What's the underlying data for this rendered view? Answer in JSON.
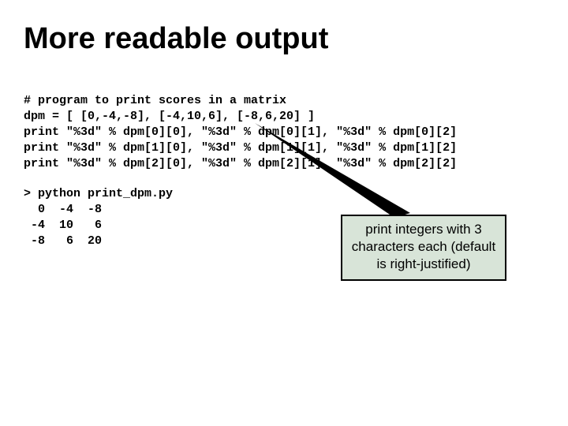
{
  "title": "More readable output",
  "code": {
    "line1": "# program to print scores in a matrix",
    "line2": "dpm = [ [0,-4,-8], [-4,10,6], [-8,6,20] ]",
    "line3": "print \"%3d\" % dpm[0][0], \"%3d\" % dpm[0][1], \"%3d\" % dpm[0][2]",
    "line4": "print \"%3d\" % dpm[1][0], \"%3d\" % dpm[1][1], \"%3d\" % dpm[1][2]",
    "line5": "print \"%3d\" % dpm[2][0], \"%3d\" % dpm[2][1], \"%3d\" % dpm[2][2]"
  },
  "output": {
    "line1": "> python print_dpm.py",
    "line2": "  0  -4  -8",
    "line3": " -4  10   6",
    "line4": " -8   6  20"
  },
  "callout_text": "print integers with 3 characters each (default is right-justified)"
}
